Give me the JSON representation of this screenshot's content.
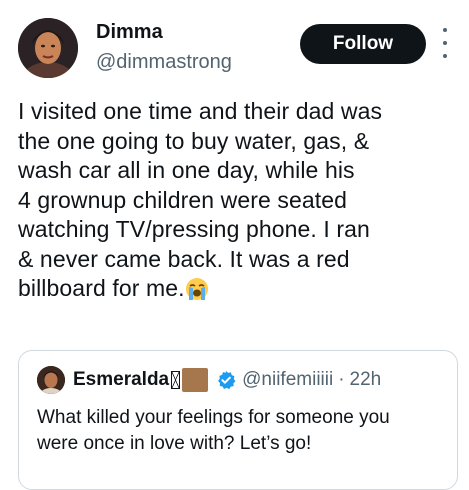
{
  "author": {
    "display_name": "Dimma",
    "handle": "@dimmastrong",
    "avatar_icon": "profile-photo"
  },
  "actions": {
    "follow_label": "Follow",
    "more_icon": "more-options-icon"
  },
  "tweet": {
    "lines": [
      "I visited one time and their dad was",
      "the one going to buy water, gas, &",
      "wash car all in one day, while his",
      "4 grownup children were seated",
      "watching TV/pressing phone. I ran",
      "& never came back. It was a red",
      "billboard for me."
    ],
    "trailing_emoji": "loudly-crying-face"
  },
  "quoted": {
    "display_name": "Esmeralda",
    "handle": "@niifemiiiii",
    "separator": "·",
    "time": "22h",
    "verified_icon": "verified-badge",
    "lines": [
      "What killed your feelings for someone you",
      "were once in love with? Let’s go!"
    ]
  },
  "colors": {
    "text_primary": "#0f1419",
    "text_secondary": "#536471",
    "follow_bg": "#0f1419",
    "verified": "#1d9bf0",
    "border": "#cfd9de"
  }
}
